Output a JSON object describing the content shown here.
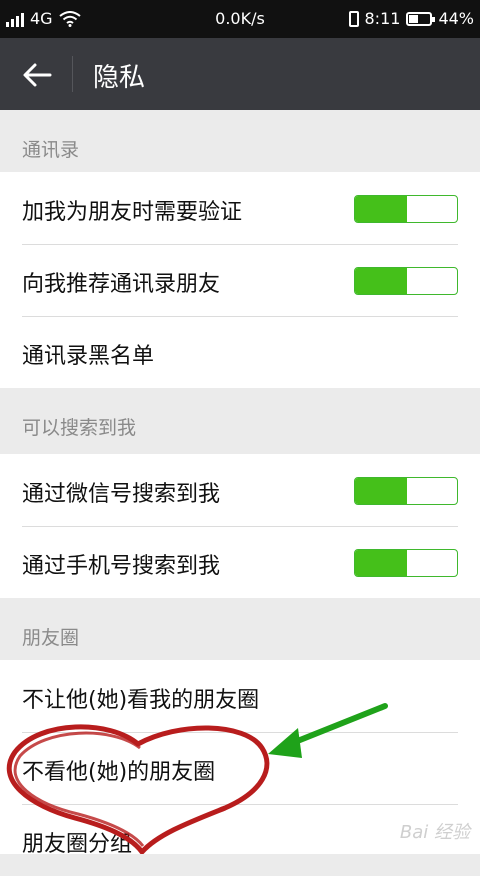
{
  "status_bar": {
    "sim": "2",
    "network": "4G",
    "speed": "0.0K/s",
    "time": "8:11",
    "battery": "44%",
    "battery_level": 0.44
  },
  "app_bar": {
    "title": "隐私"
  },
  "sections": [
    {
      "header": "通讯录",
      "rows": [
        {
          "label": "加我为朋友时需要验证",
          "toggle": true
        },
        {
          "label": "向我推荐通讯录朋友",
          "toggle": true
        },
        {
          "label": "通讯录黑名单"
        }
      ]
    },
    {
      "header": "可以搜索到我",
      "rows": [
        {
          "label": "通过微信号搜索到我",
          "toggle": true
        },
        {
          "label": "通过手机号搜索到我",
          "toggle": true
        }
      ]
    },
    {
      "header": "朋友圈",
      "rows": [
        {
          "label": "不让他(她)看我的朋友圈"
        },
        {
          "label": "不看他(她)的朋友圈"
        },
        {
          "label": "朋友圈分组"
        }
      ]
    }
  ],
  "colors": {
    "toggle_on": "#45c01a",
    "appbar": "#393a3f",
    "annotation_heart": "#b81d1d",
    "annotation_arrow": "#1fa21a"
  },
  "watermark": "Bai 经验"
}
